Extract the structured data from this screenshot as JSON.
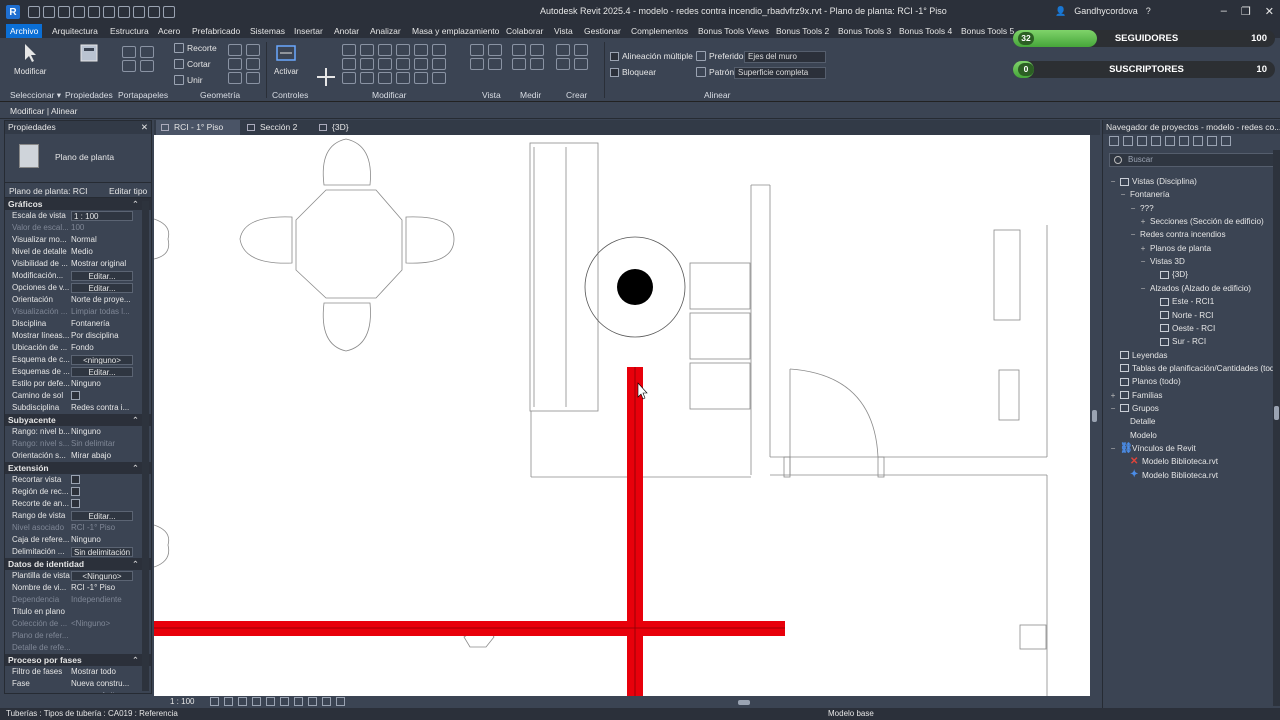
{
  "window": {
    "title": "Autodesk Revit 2025.4 - modelo - redes contra incendio_rbadvfrz9x.rvt - Plano de planta: RCI -1° Piso",
    "user": "Gandhycordova",
    "logo_letter": "R"
  },
  "ribbon_tabs": [
    "Archivo",
    "Arquitectura",
    "Estructura",
    "Acero",
    "Prefabricado",
    "Sistemas",
    "Insertar",
    "Anotar",
    "Analizar",
    "Masa y emplazamiento",
    "Colaborar",
    "Vista",
    "Gestionar",
    "Complementos",
    "Bonus Tools Views",
    "Bonus Tools 2",
    "Bonus Tools 3",
    "Bonus Tools 4",
    "Bonus Tools 5"
  ],
  "ribbon": {
    "modify_label": "Modificar",
    "recortar": "Recorte",
    "cortar": "Cortar",
    "unir": "Unir",
    "activar": "Activar",
    "alineacion_multiple": "Alineación múltiple",
    "bloquear": "Bloquear",
    "preferido_label": "Preferido:",
    "preferido_value": "Ejes del muro",
    "patron_label": "Patrón:",
    "patron_value": "Superficie completa",
    "panels": {
      "seleccionar": "Seleccionar ▾",
      "propiedades": "Propiedades",
      "portapapeles": "Portapapeles",
      "geometria": "Geometría",
      "controles": "Controles",
      "modificar": "Modificar",
      "vista": "Vista",
      "medir": "Medir",
      "crear": "Crear",
      "alinear": "Alinear"
    }
  },
  "social": {
    "followers_count": "32",
    "followers_label": "SEGUIDORES",
    "followers_goal": "100",
    "followers_progress": 0.32,
    "subscribers_count": "0",
    "subscribers_label": "SUSCRIPTORES",
    "subscribers_goal": "10",
    "subscribers_progress": 0.0
  },
  "options_bar": "Modificar | Alinear",
  "properties": {
    "title": "Propiedades",
    "type_name": "Plano de planta",
    "selector_left": "Plano de planta: RCI",
    "selector_right": "Editar tipo",
    "groups": [
      {
        "name": "Gráficos",
        "rows": [
          {
            "k": "Escala de vista",
            "v": "1 : 100",
            "kind": "inp"
          },
          {
            "k": "Valor de escal...",
            "v": "100",
            "dim": true
          },
          {
            "k": "Visualizar mo...",
            "v": "Normal"
          },
          {
            "k": "Nivel de detalle",
            "v": "Medio"
          },
          {
            "k": "Visibilidad de ...",
            "v": "Mostrar original"
          },
          {
            "k": "Modificación...",
            "v": "Editar...",
            "kind": "btn"
          },
          {
            "k": "Opciones de v...",
            "v": "Editar...",
            "kind": "btn"
          },
          {
            "k": "Orientación",
            "v": "Norte de proye..."
          },
          {
            "k": "Visualización ...",
            "v": "Limpiar todas l...",
            "dim": true
          },
          {
            "k": "Disciplina",
            "v": "Fontanería"
          },
          {
            "k": "Mostrar líneas...",
            "v": "Por disciplina"
          },
          {
            "k": "Ubicación de ...",
            "v": "Fondo"
          },
          {
            "k": "Esquema de c...",
            "v": "<ninguno>",
            "kind": "btn"
          },
          {
            "k": "Esquemas de ...",
            "v": "Editar...",
            "kind": "btn"
          },
          {
            "k": "Estilo por defe...",
            "v": "Ninguno"
          },
          {
            "k": "Camino de sol",
            "v": "",
            "kind": "chk"
          },
          {
            "k": "Subdisciplina",
            "v": "Redes contra i..."
          }
        ]
      },
      {
        "name": "Subyacente",
        "rows": [
          {
            "k": "Rango: nivel b...",
            "v": "Ninguno"
          },
          {
            "k": "Rango: nivel s...",
            "v": "Sin delimitar",
            "dim": true
          },
          {
            "k": "Orientación s...",
            "v": "Mirar abajo"
          }
        ]
      },
      {
        "name": "Extensión",
        "rows": [
          {
            "k": "Recortar vista",
            "v": "",
            "kind": "chk"
          },
          {
            "k": "Región de rec...",
            "v": "",
            "kind": "chk"
          },
          {
            "k": "Recorte de an...",
            "v": "",
            "kind": "chk"
          },
          {
            "k": "Rango de vista",
            "v": "Editar...",
            "kind": "btn"
          },
          {
            "k": "Nivel asociado",
            "v": "RCI -1° Piso",
            "dim": true
          },
          {
            "k": "Caja de refere...",
            "v": "Ninguno"
          },
          {
            "k": "Delimitación ...",
            "v": "Sin delimitación",
            "kind": "btn"
          }
        ]
      },
      {
        "name": "Datos de identidad",
        "rows": [
          {
            "k": "Plantilla de vista",
            "v": "<Ninguno>",
            "kind": "btn"
          },
          {
            "k": "Nombre de vi...",
            "v": "RCI -1° Piso"
          },
          {
            "k": "Dependencia",
            "v": "Independiente",
            "dim": true
          },
          {
            "k": "Título en plano",
            "v": ""
          },
          {
            "k": "Colección de ...",
            "v": "<Ninguno>",
            "dim": true
          },
          {
            "k": "Plano de refer...",
            "v": "",
            "dim": true
          },
          {
            "k": "Detalle de refe...",
            "v": "",
            "dim": true
          }
        ]
      },
      {
        "name": "Proceso por fases",
        "rows": [
          {
            "k": "Filtro de fases",
            "v": "Mostrar todo"
          },
          {
            "k": "Fase",
            "v": "Nueva constru..."
          }
        ]
      }
    ],
    "apply": "Aplicar"
  },
  "view_tabs": [
    "RCI - 1° Piso",
    "Sección 2",
    "{3D}"
  ],
  "view_bar": {
    "scale": "1 : 100"
  },
  "status_bar": {
    "message": "Tuberías : Tipos de tubería : CA019 : Referencia",
    "model": "Modelo base"
  },
  "browser": {
    "title": "Navegador de proyectos - modelo - redes co...",
    "search_placeholder": "Buscar",
    "items": [
      {
        "label": "Vistas (Disciplina)",
        "indent": 0,
        "exp": "−",
        "icon": "box"
      },
      {
        "label": "Fontanería",
        "indent": 1,
        "exp": "−"
      },
      {
        "label": "???",
        "indent": 2,
        "exp": "−"
      },
      {
        "label": "Secciones (Sección de edificio)",
        "indent": 3,
        "exp": "+"
      },
      {
        "label": "Redes contra incendios",
        "indent": 2,
        "exp": "−"
      },
      {
        "label": "Planos de planta",
        "indent": 3,
        "exp": "+"
      },
      {
        "label": "Vistas 3D",
        "indent": 3,
        "exp": "−"
      },
      {
        "label": "{3D}",
        "indent": 4,
        "exp": "",
        "icon": "box"
      },
      {
        "label": "Alzados (Alzado de edificio)",
        "indent": 3,
        "exp": "−"
      },
      {
        "label": "Este - RCI1",
        "indent": 4,
        "exp": "",
        "icon": "box"
      },
      {
        "label": "Norte - RCI",
        "indent": 4,
        "exp": "",
        "icon": "box"
      },
      {
        "label": "Oeste - RCI",
        "indent": 4,
        "exp": "",
        "icon": "box"
      },
      {
        "label": "Sur - RCI",
        "indent": 4,
        "exp": "",
        "icon": "box"
      },
      {
        "label": "Leyendas",
        "indent": 0,
        "exp": "",
        "icon": "box"
      },
      {
        "label": "Tablas de planificación/Cantidades (todo)",
        "indent": 0,
        "exp": "",
        "icon": "box"
      },
      {
        "label": "Planos (todo)",
        "indent": 0,
        "exp": "",
        "icon": "box"
      },
      {
        "label": "Familias",
        "indent": 0,
        "exp": "+",
        "icon": "box"
      },
      {
        "label": "Grupos",
        "indent": 0,
        "exp": "−",
        "icon": "box"
      },
      {
        "label": "Detalle",
        "indent": 1,
        "exp": ""
      },
      {
        "label": "Modelo",
        "indent": 1,
        "exp": ""
      },
      {
        "label": "Vínculos de Revit",
        "indent": 0,
        "exp": "−",
        "icon": "link"
      },
      {
        "label": "Modelo Biblioteca.rvt",
        "indent": 1,
        "exp": "",
        "icon": "red"
      },
      {
        "label": "Modelo Biblioteca.rvt",
        "indent": 1,
        "exp": "",
        "icon": "blue"
      }
    ]
  },
  "colors": {
    "pipe_red": "#e8000b",
    "accent_blue": "#0b6fd6"
  }
}
